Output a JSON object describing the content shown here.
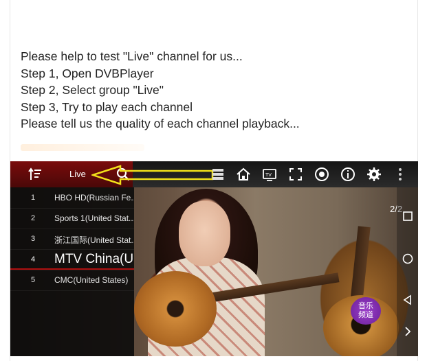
{
  "message": {
    "lines": [
      "Please help to test \"Live\" channel for us...",
      "Step 1, Open DVBPlayer",
      "Step 2, Select group \"Live\"",
      "Step 3, Try to play each channel",
      "Please tell us the quality of each channel playback..."
    ]
  },
  "app": {
    "group_label": "Live",
    "page_indicator": "2/2",
    "toolbar_icons": [
      "sort-icon",
      "search-icon",
      "server-icon",
      "home-icon",
      "tv-icon",
      "fullscreen-icon",
      "record-icon",
      "info-icon",
      "settings-icon",
      "more-icon"
    ],
    "channels": [
      {
        "num": "1",
        "name": "HBO HD(Russian Fe..."
      },
      {
        "num": "2",
        "name": "Sports 1(United Stat..."
      },
      {
        "num": "3",
        "name": "浙江国际(United Stat..."
      },
      {
        "num": "4",
        "name": "MTV China(U"
      },
      {
        "num": "5",
        "name": "CMC(United States)"
      }
    ],
    "selected_channel_index": 3,
    "logo_text": "音乐\n频道",
    "colors": {
      "accent_red": "#7a0c0c",
      "arrow_yellow": "#f2e21a"
    }
  }
}
